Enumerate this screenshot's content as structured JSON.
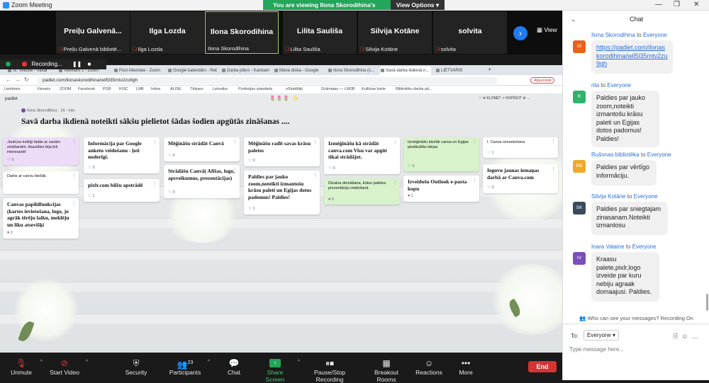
{
  "zoom": {
    "window_title": "Zoom Meeting",
    "share_banner": "You are viewing Ilona Skorodihina's screen",
    "view_options": "View Options",
    "gallery_view_label": "View",
    "recording_label": "Recording..."
  },
  "gallery": [
    {
      "name": "Preiļu  Galvenā...",
      "sub": "Preiļu Galvenā bibliotē...",
      "muted": true,
      "active": false
    },
    {
      "name": "Ilga Lozda",
      "sub": "Ilga Lozda",
      "muted": true,
      "active": false
    },
    {
      "name": "Ilona Skorodihina",
      "sub": "Ilona Skorodihina",
      "muted": false,
      "active": true
    },
    {
      "name": "Lilita Sauliša",
      "sub": "Lilita Sauliša",
      "muted": true,
      "active": false
    },
    {
      "name": "Silvija Kotāne",
      "sub": "Silvija Kotāne",
      "muted": true,
      "active": false
    },
    {
      "name": "solvita",
      "sub": "solvita",
      "muted": true,
      "active": false
    }
  ],
  "browser": {
    "tabs": [
      "Sl. Vebsite - Vasar",
      "Vebinārs 1 - Zoom",
      "Post Attendee - Zoom",
      "Google kalendārs - ReDate",
      "Darba plāns - Kanbani",
      "Mana diska - Google",
      "Ilona Skorodihina (s...",
      "Savā darba ikdienā n...",
      "LIETVARIS"
    ],
    "url": "padlet.com/ilonaskorodihina/wil5l35mtv2zu9gh",
    "paused": "Atjaunināt",
    "bookmarks": [
      "Lietotnes",
      "Visvaris",
      "ZOOM",
      "Facebook",
      "PGB",
      "KISC",
      "LNB",
      "Inbox",
      "ALISE",
      "Tēlparu",
      "Letonika",
      "Profesijas standarts",
      "eSkaitītāji",
      "Grāmatas — LNDB",
      "Kultūras karte",
      "Bibliotēku darba pā..."
    ]
  },
  "padlet": {
    "brand": "padlet",
    "emoji": "🌷🌷🌷 ✨",
    "actions": "♡ ✉ KLONĒT  ↗ KOPĪGOT  ⚙  …",
    "author": "Ilona Skorodihina · 16 · min.",
    "title": "Savā darba ikdienā noteikti sākšu pielietot šādas šodien apgūtās zināšanas ....",
    "fab": "+",
    "cards": [
      {
        "text": "Jauki,ka kolēģi dalās ar savām zināšanām, klausīties bija ļoti interesanti!",
        "likes": "♡ 0",
        "style": "small purple"
      },
      {
        "text": "Darbs ar canvu biežāk.",
        "likes": "",
        "style": "small"
      },
      {
        "text": "Canvas papildfunkcijas (kartes ievietošana, logo, jo agrāk tērēju laiku, meklēju un liku atsevišķi",
        "likes": "♥ 2",
        "style": "bold"
      },
      {
        "text": "Informācija par Google anketu veidošanu - ļoti noderīgi.",
        "likes": "♡ 0",
        "style": "bold"
      },
      {
        "text": "pixlr.com bilžu apstrādē",
        "likes": "♡ 1",
        "style": "bold"
      },
      {
        "text": "Mēģināšu strādāt Canvā",
        "likes": "♡ 0",
        "style": "bold"
      },
      {
        "text": "Strādāšu Canvā( Afišas, logo, apsveikumus, prezentācijas)",
        "likes": "♡ 0",
        "style": "bold"
      },
      {
        "text": "Mēģināšu radīt savas krāsu paletes",
        "likes": "♡ 0",
        "style": "bold"
      },
      {
        "text": "Paldies par jauko zoom,noteikti izmantošu krāsu paleti un Egijas dotos padomus! Paldies!",
        "likes": "♡ 1",
        "style": "bold"
      },
      {
        "text": "Izmēģināšu kā strādāt canva.com Visu var apgūt tikai strādājot.",
        "likes": "♡ 0",
        "style": "bold"
      },
      {
        "text": "Dizaina domāšana, krāsu paletes prezentāciju veidošanā.",
        "likes": "♥ 0",
        "style": "small green"
      },
      {
        "text": "Izmēģināšu biežāk canva un Egijas piedāvātās idejas",
        "likes": "♡ 0",
        "style": "small green"
      },
      {
        "text": "Izveidošu Outlook e-pasta kopu",
        "likes": "♥ 1",
        "style": "bold"
      },
      {
        "text": "I. Canva izmantošana",
        "likes": "♡ 1",
        "style": "small"
      },
      {
        "text": "Ieguvu jaunas iemaņas darbā ar Canva.com",
        "likes": "♡ 0",
        "style": "bold"
      }
    ]
  },
  "toolbar": {
    "unmute": "Unmute",
    "start_video": "Start Video",
    "security": "Security",
    "participants": "Participants",
    "participants_count": "23",
    "chat": "Chat",
    "share_screen": "Share Screen",
    "record": "Pause/Stop Recording",
    "breakout": "Breakout Rooms",
    "reactions": "Reactions",
    "more": "More",
    "end": "End"
  },
  "chat": {
    "title": "Chat",
    "messages": [
      {
        "sender": "Ilona Skorodihina",
        "to": "to",
        "target": "Everyone",
        "initials": "IS",
        "color": "#e8621a",
        "text": "https://padlet.com/ilonaskorodihina/wil5l35mtv2zu9gh",
        "is_link": true
      },
      {
        "sender": "rita",
        "to": "to",
        "target": "Everyone",
        "initials": "R",
        "color": "#2fb36b",
        "text": "Paldies par jauko zoom,noteikti izmantošu krāsu paleti un Egijas dotos padomus! Paldies!",
        "is_link": false
      },
      {
        "sender": "Rušonas bibliotēka",
        "to": "to",
        "target": "Everyone",
        "initials": "RB",
        "color": "#f0a92a",
        "text": "Paldies par vērtīgo informāciju.",
        "is_link": false
      },
      {
        "sender": "Silvija Kotāne",
        "to": "to",
        "target": "Everyone",
        "initials": "SK",
        "color": "#3a4a5e",
        "text": "Paldies par sniegtajam zinasanam.Noteikti izmantosu",
        "is_link": false
      },
      {
        "sender": "Inara Valaine",
        "to": "to",
        "target": "Everyone",
        "initials": "IV",
        "color": "#7b4fb8",
        "text": "Kraasu palete,pixlr,logo izveide par kuru nebiju agraak domaajusi. Paldies.",
        "is_link": false
      }
    ],
    "privacy": "Who can see your messages? Recording On",
    "to_label": "To:",
    "to_value": "Everyone",
    "placeholder": "Type message here..."
  }
}
